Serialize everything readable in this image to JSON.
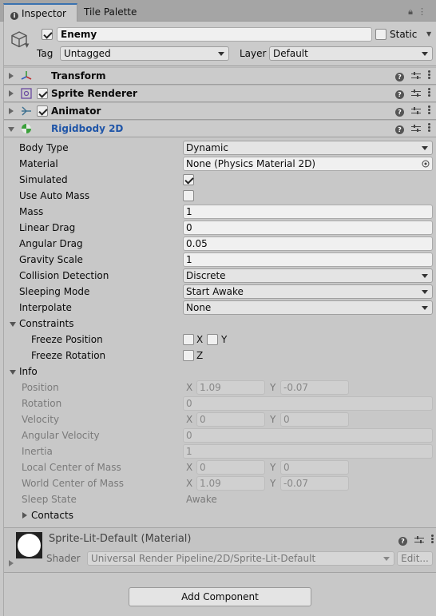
{
  "tabs": {
    "inspector": "Inspector",
    "tile_palette": "Tile Palette"
  },
  "object": {
    "name": "Enemy",
    "static_label": "Static",
    "tag_label": "Tag",
    "tag_value": "Untagged",
    "layer_label": "Layer",
    "layer_value": "Default"
  },
  "components": {
    "transform": "Transform",
    "sprite_renderer": "Sprite Renderer",
    "animator": "Animator",
    "rigidbody": "Rigidbody 2D"
  },
  "rigidbody": {
    "body_type_label": "Body Type",
    "body_type": "Dynamic",
    "material_label": "Material",
    "material": "None (Physics Material 2D)",
    "simulated_label": "Simulated",
    "use_auto_mass_label": "Use Auto Mass",
    "mass_label": "Mass",
    "mass": "1",
    "linear_drag_label": "Linear Drag",
    "linear_drag": "0",
    "angular_drag_label": "Angular Drag",
    "angular_drag": "0.05",
    "gravity_scale_label": "Gravity Scale",
    "gravity_scale": "1",
    "collision_detection_label": "Collision Detection",
    "collision_detection": "Discrete",
    "sleeping_mode_label": "Sleeping Mode",
    "sleeping_mode": "Start Awake",
    "interpolate_label": "Interpolate",
    "interpolate": "None",
    "constraints_label": "Constraints",
    "freeze_position_label": "Freeze Position",
    "freeze_rotation_label": "Freeze Rotation",
    "axis_x": "X",
    "axis_y": "Y",
    "axis_z": "Z"
  },
  "info": {
    "label": "Info",
    "position_label": "Position",
    "position_x": "1.09",
    "position_y": "-0.07",
    "rotation_label": "Rotation",
    "rotation": "0",
    "velocity_label": "Velocity",
    "velocity_x": "0",
    "velocity_y": "0",
    "angular_velocity_label": "Angular Velocity",
    "angular_velocity": "0",
    "inertia_label": "Inertia",
    "inertia": "1",
    "local_com_label": "Local Center of Mass",
    "local_com_x": "0",
    "local_com_y": "0",
    "world_com_label": "World Center of Mass",
    "world_com_x": "1.09",
    "world_com_y": "-0.07",
    "sleep_state_label": "Sleep State",
    "sleep_state": "Awake",
    "contacts_label": "Contacts",
    "axis_x": "X",
    "axis_y": "Y"
  },
  "material": {
    "title": "Sprite-Lit-Default (Material)",
    "shader_label": "Shader",
    "shader_value": "Universal Render Pipeline/2D/Sprite-Lit-Default",
    "edit_label": "Edit..."
  },
  "add_component": "Add Component",
  "colors": {
    "accent": "#3a72b0",
    "component_title_active": "#1f55a8"
  }
}
